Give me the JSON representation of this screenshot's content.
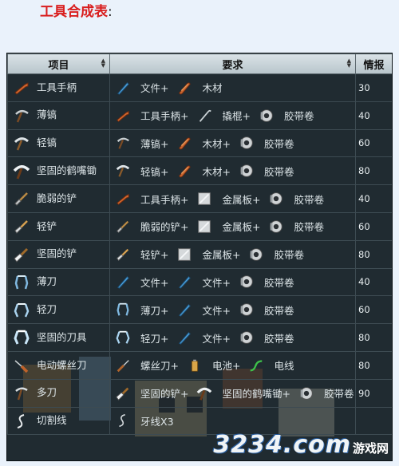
{
  "title": {
    "text": "工具合成表",
    "colon": ":"
  },
  "table": {
    "headers": [
      "项目",
      "要求",
      "情报"
    ],
    "rows": [
      {
        "item": "工具手柄",
        "item_icon": "tool-handle-icon",
        "req": [
          {
            "icon": "file-icon",
            "text": "文件+"
          },
          {
            "icon": "wood-icon",
            "text": "木材"
          }
        ],
        "info": "30"
      },
      {
        "item": "薄镐",
        "item_icon": "thin-pickaxe-icon",
        "req": [
          {
            "icon": "tool-handle-icon",
            "text": "工具手柄+"
          },
          {
            "icon": "crowbar-icon",
            "text": "撬棍+"
          },
          {
            "icon": "tape-icon",
            "text": "胶带卷"
          }
        ],
        "info": "40"
      },
      {
        "item": "轻镐",
        "item_icon": "light-pickaxe-icon",
        "req": [
          {
            "icon": "thin-pickaxe-icon",
            "text": "薄镐+"
          },
          {
            "icon": "wood-icon",
            "text": "木材+"
          },
          {
            "icon": "tape-icon",
            "text": "胶带卷"
          }
        ],
        "info": "60"
      },
      {
        "item": "坚固的鹤嘴锄",
        "item_icon": "sturdy-pickaxe-icon",
        "req": [
          {
            "icon": "light-pickaxe-icon",
            "text": "轻镐+"
          },
          {
            "icon": "wood-icon",
            "text": "木材+"
          },
          {
            "icon": "tape-icon",
            "text": "胶带卷"
          }
        ],
        "info": "80"
      },
      {
        "item": "脆弱的铲",
        "item_icon": "fragile-shovel-icon",
        "req": [
          {
            "icon": "tool-handle-icon",
            "text": "工具手柄+"
          },
          {
            "icon": "metal-sheet-icon",
            "text": "金属板+"
          },
          {
            "icon": "tape-icon",
            "text": "胶带卷"
          }
        ],
        "info": "40"
      },
      {
        "item": "轻铲",
        "item_icon": "light-shovel-icon",
        "req": [
          {
            "icon": "fragile-shovel-icon",
            "text": "脆弱的铲+"
          },
          {
            "icon": "metal-sheet-icon",
            "text": "金属板+"
          },
          {
            "icon": "tape-icon",
            "text": "胶带卷"
          }
        ],
        "info": "60"
      },
      {
        "item": "坚固的铲",
        "item_icon": "sturdy-shovel-icon",
        "req": [
          {
            "icon": "light-shovel-icon",
            "text": "轻铲+"
          },
          {
            "icon": "metal-sheet-icon",
            "text": "金属板+"
          },
          {
            "icon": "tape-icon",
            "text": "胶带卷"
          }
        ],
        "info": "80"
      },
      {
        "item": "薄刀",
        "item_icon": "thin-blade-icon",
        "req": [
          {
            "icon": "file-icon",
            "text": "文件+"
          },
          {
            "icon": "file-icon",
            "text": "文件+"
          },
          {
            "icon": "tape-icon",
            "text": "胶带卷"
          }
        ],
        "info": "40"
      },
      {
        "item": "轻刀",
        "item_icon": "light-blade-icon",
        "req": [
          {
            "icon": "thin-blade-icon",
            "text": "薄刀+"
          },
          {
            "icon": "file-icon",
            "text": "文件+"
          },
          {
            "icon": "tape-icon",
            "text": "胶带卷"
          }
        ],
        "info": "60"
      },
      {
        "item": "坚固的刀具",
        "item_icon": "sturdy-blade-icon",
        "req": [
          {
            "icon": "light-blade-icon",
            "text": "轻刀+"
          },
          {
            "icon": "file-icon",
            "text": "文件+"
          },
          {
            "icon": "tape-icon",
            "text": "胶带卷"
          }
        ],
        "info": "80"
      },
      {
        "item": "电动螺丝刀",
        "item_icon": "electric-screwdriver-icon",
        "req": [
          {
            "icon": "screwdriver-icon",
            "text": "螺丝刀+"
          },
          {
            "icon": "battery-icon",
            "text": "电池+"
          },
          {
            "icon": "wire-icon",
            "text": "电线"
          }
        ],
        "info": "80"
      },
      {
        "item": "多刀",
        "item_icon": "multi-tool-icon",
        "req": [
          {
            "icon": "sturdy-shovel-icon",
            "text": "坚固的铲+"
          },
          {
            "icon": "sturdy-pickaxe-icon",
            "text": "坚固的鹤嘴锄+"
          },
          {
            "icon": "tape-icon",
            "text": "胶带卷"
          }
        ],
        "info": "90"
      },
      {
        "item": "切割线",
        "item_icon": "cutting-wire-icon",
        "req": [
          {
            "icon": "floss-icon",
            "text": "牙线X3"
          }
        ],
        "info": ""
      }
    ]
  },
  "watermark": {
    "number": "3234",
    "dot": ".com",
    "site": "游戏网"
  }
}
